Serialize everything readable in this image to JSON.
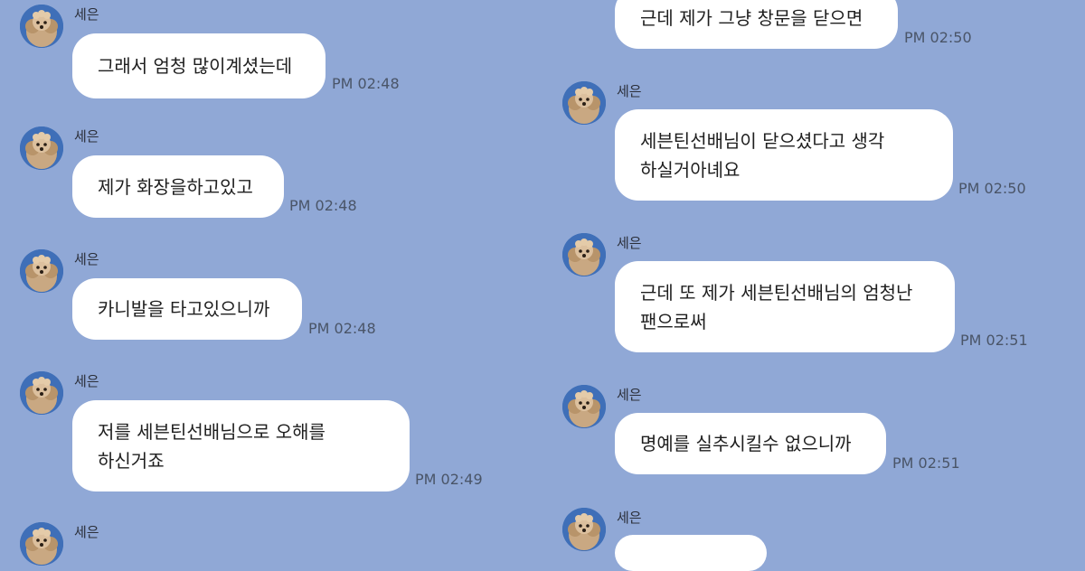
{
  "chat": {
    "messages_left": [
      {
        "sender": "세은",
        "lines": [
          "그래서 엄청 많이계셨는데"
        ],
        "time": "PM 02:48"
      },
      {
        "sender": "세은",
        "lines": [
          "제가 화장을하고있고"
        ],
        "time": "PM 02:48"
      },
      {
        "sender": "세은",
        "lines": [
          "카니발을 타고있으니까"
        ],
        "time": "PM 02:48"
      },
      {
        "sender": "세은",
        "lines": [
          "저를 세븐틴선배님으로 오해를",
          "하신거죠"
        ],
        "time": "PM 02:49"
      },
      {
        "sender": "세은"
      }
    ],
    "messages_right": [
      {
        "lines": [
          "근데 제가 그냥 창문을 닫으면"
        ],
        "time": "PM 02:50"
      },
      {
        "sender": "세은",
        "lines": [
          "세븐틴선배님이 닫으셨다고 생각",
          "하실거아녜요"
        ],
        "time": "PM 02:50"
      },
      {
        "sender": "세은",
        "lines": [
          "근데 또 제가 세븐틴선배님의 엄청난",
          "팬으로써"
        ],
        "time": "PM 02:51"
      },
      {
        "sender": "세은",
        "lines": [
          "명예를 실추시킬수 없으니까"
        ],
        "time": "PM 02:51"
      },
      {
        "sender": "세은"
      }
    ]
  },
  "colors": {
    "background": "#90a8d6",
    "bubble": "#ffffff",
    "avatar_bg": "#3f6fb8"
  }
}
